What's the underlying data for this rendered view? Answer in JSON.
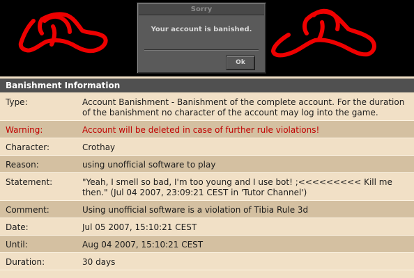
{
  "dialog": {
    "title": "Sorry",
    "message": "Your account is banished.",
    "ok_label": "Ok"
  },
  "doodle_color": "#ee0000",
  "info": {
    "header": "Banishment Information",
    "rows": [
      {
        "label": "Type:",
        "value": "Account Banishment - Banishment of the complete account. For the duration of the banishment no character of the account may log into the game."
      },
      {
        "label": "Warning:",
        "value": "Account will be deleted in case of further rule violations!"
      },
      {
        "label": "Character:",
        "value": "Crothay"
      },
      {
        "label": "Reason:",
        "value": "using unofficial software to play"
      },
      {
        "label": "Statement:",
        "value": "\"Yeah, I smell so bad, I'm too young and I use bot! ;<<<<<<<<< Kill me then.\" (Jul 04 2007, 23:09:21 CEST in 'Tutor Channel')"
      },
      {
        "label": "Comment:",
        "value": "Using unofficial software is a violation of Tibia Rule 3d"
      },
      {
        "label": "Date:",
        "value": "Jul 05 2007, 15:10:21 CEST"
      },
      {
        "label": "Until:",
        "value": "Aug 04 2007, 15:10:21 CEST"
      },
      {
        "label": "Duration:",
        "value": "30 days"
      }
    ]
  }
}
